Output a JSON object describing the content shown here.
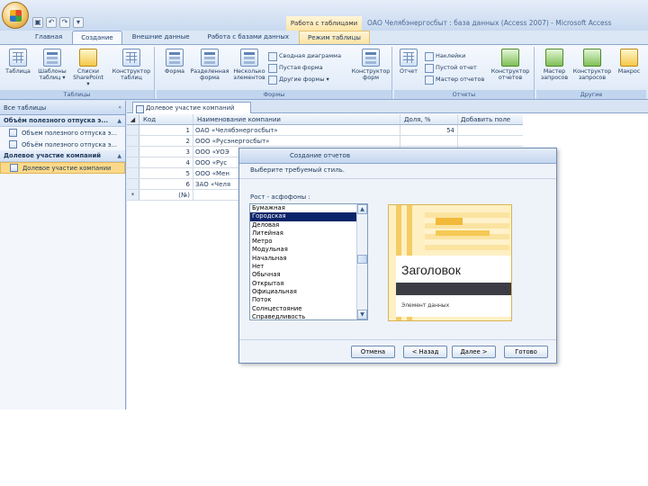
{
  "titlebar": {
    "context_title": "Работа с таблицами",
    "window_title": "ОАО Челябэнергосбыт : база данных (Access 2007) - Microsoft Access",
    "qat": [
      "▣",
      "↶",
      "↷",
      "▾"
    ]
  },
  "tabs": [
    {
      "label": "Главная"
    },
    {
      "label": "Создание"
    },
    {
      "label": "Внешние данные"
    },
    {
      "label": "Работа с базами данных"
    },
    {
      "label": "Режим таблицы"
    }
  ],
  "ribbon": {
    "groups": {
      "tables": {
        "label": "Таблицы",
        "buttons": [
          "Таблица",
          "Шаблоны таблиц ▾",
          "Списки SharePoint ▾",
          "Конструктор таблиц"
        ]
      },
      "forms": {
        "label": "Формы",
        "buttons": [
          "Форма",
          "Разделенная форма",
          "Несколько элементов"
        ],
        "small": [
          "Сводная диаграмма",
          "Пустая форма",
          "Другие формы ▾"
        ],
        "big_right": "Конструктор форм"
      },
      "reports": {
        "label": "Отчеты",
        "buttons": [
          "Отчет"
        ],
        "small": [
          "Наклейки",
          "Пустой отчет",
          "Мастер отчетов"
        ],
        "big_right": "Конструктор отчетов"
      },
      "other": {
        "label": "Другие",
        "buttons": [
          "Мастер запросов",
          "Конструктор запросов",
          "Макрос"
        ]
      }
    }
  },
  "nav": {
    "header": "Все таблицы",
    "categories": [
      {
        "label": "Объём полезного отпуска э...",
        "items": [
          "Объем полезного отпуска э...",
          "Объём полезного отпуска э..."
        ]
      },
      {
        "label": "Долевое участие компаний",
        "items": [
          "Долевое участие компании"
        ]
      }
    ]
  },
  "document": {
    "tab_label": "Долевое участие компаний",
    "columns": [
      "Код",
      "Наименование компании",
      "Доля, %",
      "Добавить поле"
    ],
    "rows": [
      {
        "code": "1",
        "name": "ОАО «Челябэнергосбыт»",
        "share": "54"
      },
      {
        "code": "2",
        "name": "ООО «Русэнергосбыт»",
        "share": ""
      },
      {
        "code": "3",
        "name": "ООО «УОЭ",
        "share": ""
      },
      {
        "code": "4",
        "name": "ООО «Рус",
        "share": ""
      },
      {
        "code": "5",
        "name": "ООО «Мен",
        "share": ""
      },
      {
        "code": "6",
        "name": "ЗАО «Челя",
        "share": ""
      }
    ],
    "new_row": {
      "marker": "*",
      "code": "(№)"
    }
  },
  "dialog": {
    "title": "Создание отчетов",
    "prompt": "Выберите требуемый стиль.",
    "list_label": "Рост - асфофоны :",
    "options": [
      "Бумажная",
      "Городская",
      "Деловая",
      "Литейная",
      "Метро",
      "Модульная",
      "Начальная",
      "Нет",
      "Обычная",
      "Открытая",
      "Официальная",
      "Поток",
      "Солнцестояние",
      "Справедливость"
    ],
    "selected_index": 1,
    "preview_heading": "Заголовок",
    "preview_label": "Элемент данных",
    "buttons": {
      "cancel": "Отмена",
      "back": "< Назад",
      "next": "Далее >",
      "finish": "Готово"
    }
  },
  "colors": {
    "ribbon_bg": "#dce8f7",
    "selection": "#0a246a",
    "nav_selected": "#fbd989",
    "context_tab": "#fde6a8"
  }
}
